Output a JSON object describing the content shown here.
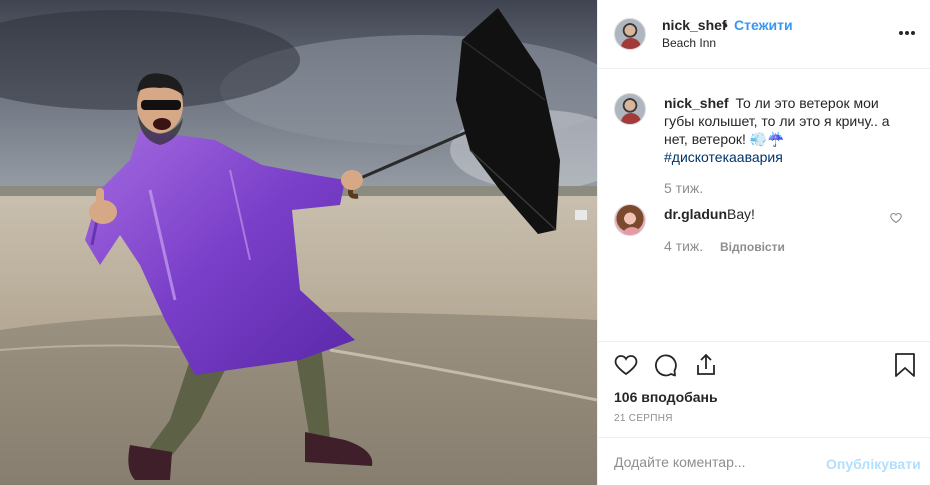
{
  "header": {
    "username": "nick_shef",
    "separator": "•",
    "follow_label": "Стежити",
    "location": "Beach Inn",
    "more_icon": "more-icon"
  },
  "caption": {
    "username": "nick_shef",
    "text": "То ли это ветерок мои губы колышет, то ли это я кричу.. а нет, ветерок! 💨☔",
    "hashtag": "#дискотекаавария",
    "time": "5 тиж."
  },
  "comments": [
    {
      "username": "dr.gladun",
      "text": "Вау!",
      "time": "4 тиж.",
      "reply_label": "Відповісти"
    }
  ],
  "actions": {
    "icons": [
      "heart-icon",
      "comment-icon",
      "share-icon",
      "bookmark-icon"
    ],
    "likes": "106 вподобань",
    "date": "21 СЕРПНЯ"
  },
  "add_comment": {
    "placeholder": "Додайте коментар...",
    "post_label": "Опублікувати"
  },
  "colors": {
    "link": "#3897f0",
    "hashtag": "#003569",
    "muted": "#8e8e8e",
    "post_disabled": "#b2dffc"
  }
}
